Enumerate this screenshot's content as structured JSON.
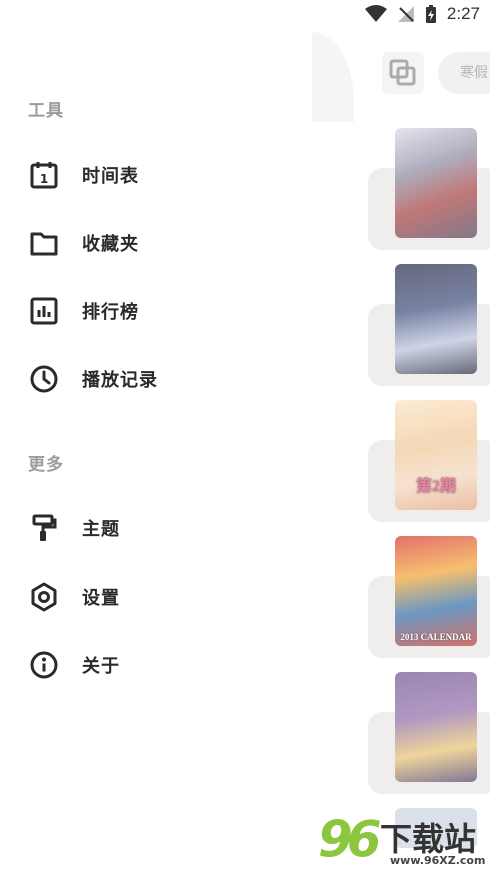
{
  "status_bar": {
    "time": "2:27"
  },
  "drawer": {
    "sections": [
      {
        "title": "工具",
        "items": [
          {
            "label": "时间表",
            "icon": "calendar-icon"
          },
          {
            "label": "收藏夹",
            "icon": "folder-icon"
          },
          {
            "label": "排行榜",
            "icon": "chart-icon"
          },
          {
            "label": "播放记录",
            "icon": "clock-icon"
          }
        ]
      },
      {
        "title": "更多",
        "items": [
          {
            "label": "主题",
            "icon": "paint-roller-icon"
          },
          {
            "label": "设置",
            "icon": "settings-hex-icon"
          },
          {
            "label": "关于",
            "icon": "info-icon"
          }
        ]
      }
    ]
  },
  "background": {
    "chip_label": "寒假",
    "poster_captions": [
      "",
      "",
      "第2期",
      "2013 CALENDAR",
      ""
    ]
  },
  "watermark": {
    "number": "96",
    "text": "下载站",
    "url": "www.96XZ.com"
  },
  "colors": {
    "section": "#9b9b9b",
    "label": "#2a2a2a",
    "watermark_green": "#8cc63f"
  }
}
